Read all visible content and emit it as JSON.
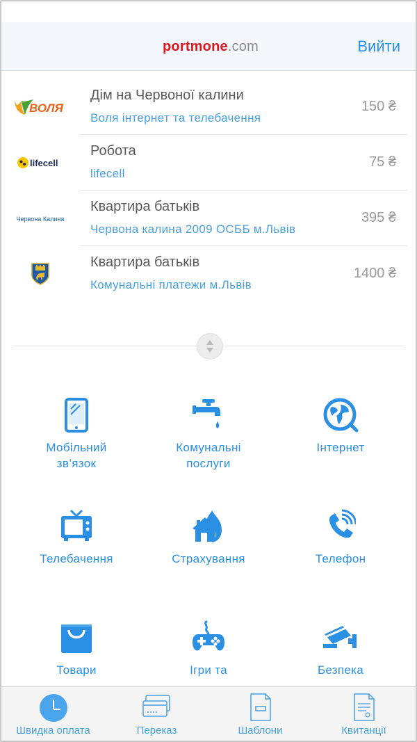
{
  "header": {
    "logo_brand": "portmone",
    "logo_tld": ".com",
    "logout_label": "Вийти"
  },
  "payments": [
    {
      "name": "Дім на Червоної калини",
      "provider": "Воля інтернет та телебачення",
      "amount": "150 ₴",
      "logo": "volia-logo",
      "logo_text": "ВОЛЯ"
    },
    {
      "name": "Робота",
      "provider": "lifecell",
      "amount": "75 ₴",
      "logo": "lifecell-logo",
      "logo_text": "lifecell"
    },
    {
      "name": "Квартира батьків",
      "provider": "Червона калина 2009 ОСББ м.Львів",
      "amount": "395 ₴",
      "logo": "chervona-kalyna-logo",
      "logo_text": "Червона Калина"
    },
    {
      "name": "Квартира батьків",
      "provider": "Комунальні платежи м.Львів",
      "amount": "1400 ₴",
      "logo": "lviv-coat-of-arms-logo",
      "logo_text": ""
    }
  ],
  "categories": [
    {
      "label": "Мобільний зв’язок",
      "line1": "Мобільний",
      "line2": "зв’язок",
      "icon": "mobile-phone-icon"
    },
    {
      "label": "Комунальні послуги",
      "line1": "Комунальні",
      "line2": "послуги",
      "icon": "water-tap-icon"
    },
    {
      "label": "Інтернет",
      "line1": "Інтернет",
      "line2": "",
      "icon": "globe-icon"
    },
    {
      "label": "Телебачення",
      "line1": "Телебачення",
      "line2": "",
      "icon": "tv-icon"
    },
    {
      "label": "Страхування",
      "line1": "Страхування",
      "line2": "",
      "icon": "house-fire-icon"
    },
    {
      "label": "Телефон",
      "line1": "Телефон",
      "line2": "",
      "icon": "phone-icon"
    },
    {
      "label": "Товари",
      "line1": "Товари",
      "line2": "",
      "icon": "shopping-bag-icon"
    },
    {
      "label": "Ігри та",
      "line1": "Ігри та",
      "line2": "",
      "icon": "gamepad-icon"
    },
    {
      "label": "Безпека",
      "line1": "Безпека",
      "line2": "",
      "icon": "security-camera-icon"
    }
  ],
  "tabs": [
    {
      "label": "Швидка оплата",
      "icon": "clock-icon",
      "active": true
    },
    {
      "label": "Переказ",
      "icon": "cards-icon",
      "active": false
    },
    {
      "label": "Шаблони",
      "icon": "document-icon",
      "active": false
    },
    {
      "label": "Квитанції",
      "icon": "receipt-icon",
      "active": false
    }
  ],
  "colors": {
    "accent": "#2b8fe3",
    "brand_red": "#e0161f",
    "header_bg": "#f4f8fc",
    "tabbar_bg": "#f4f4f4"
  }
}
